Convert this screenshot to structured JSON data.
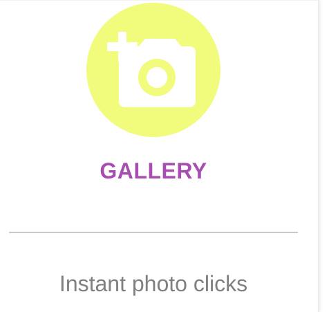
{
  "card": {
    "icon": "add-photo-camera-icon",
    "icon_background_color": "#f1fb7c",
    "title": "GALLERY",
    "title_color": "#a64fb0",
    "subtitle": "Instant photo clicks",
    "subtitle_color": "#808080"
  }
}
